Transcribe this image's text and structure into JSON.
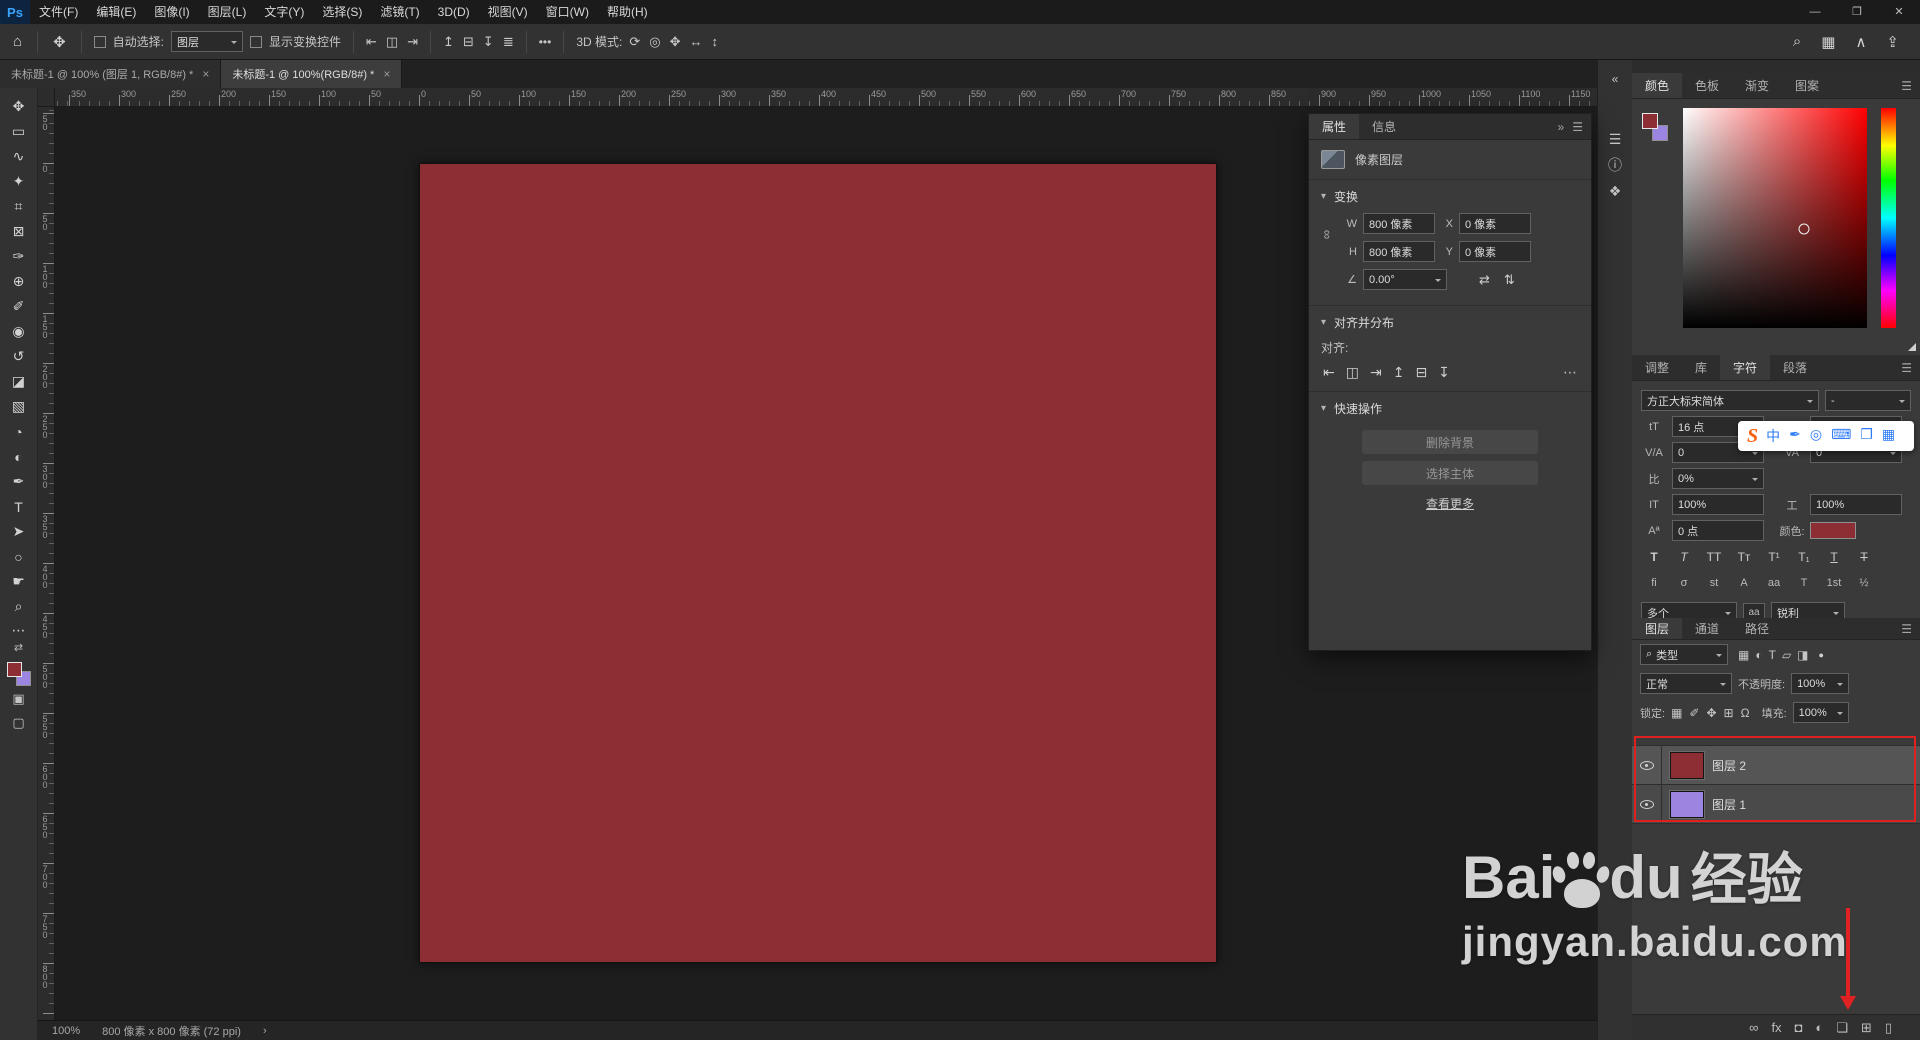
{
  "colors": {
    "doc_red": "#8c2e33",
    "purple": "#9c85e0",
    "annotation": "#e01f1f"
  },
  "menu": {
    "logo": "Ps",
    "items": [
      "文件(F)",
      "编辑(E)",
      "图像(I)",
      "图层(L)",
      "文字(Y)",
      "选择(S)",
      "滤镜(T)",
      "3D(D)",
      "视图(V)",
      "窗口(W)",
      "帮助(H)"
    ]
  },
  "window_controls": [
    {
      "name": "minimize-button",
      "glyph": "—"
    },
    {
      "name": "restore-button",
      "glyph": "❐"
    },
    {
      "name": "close-button",
      "glyph": "✕"
    }
  ],
  "options_bar": {
    "home_glyph": "⌂",
    "tool_glyph": "✥",
    "auto_select_label": "自动选择:",
    "auto_select_value": "图层",
    "show_transform_label": "显示变换控件",
    "align_icons_1": [
      {
        "name": "align-left-icon",
        "glyph": "⇤"
      },
      {
        "name": "align-center-horizontal-icon",
        "glyph": "◫"
      },
      {
        "name": "align-right-icon",
        "glyph": "⇥"
      }
    ],
    "align_icons_2": [
      {
        "name": "align-top-icon",
        "glyph": "↥"
      },
      {
        "name": "align-middle-vertical-icon",
        "glyph": "⊟"
      },
      {
        "name": "align-bottom-icon",
        "glyph": "↧"
      },
      {
        "name": "distribute-icon",
        "glyph": "≣"
      }
    ],
    "ellipsis": "•••",
    "mode_3d_label": "3D 模式:",
    "mode_3d_icons": [
      {
        "name": "3d-orbit-icon",
        "glyph": "⟳"
      },
      {
        "name": "3d-roll-icon",
        "glyph": "◎"
      },
      {
        "name": "3d-pan-icon",
        "glyph": "✥"
      },
      {
        "name": "3d-slide-icon",
        "glyph": "↔"
      },
      {
        "name": "3d-scale-icon",
        "glyph": "↕"
      }
    ],
    "right_icons": [
      {
        "name": "search-icon",
        "glyph": "⌕"
      },
      {
        "name": "workspace-switcher-icon",
        "glyph": "▦"
      },
      {
        "name": "chevron-icon",
        "glyph": "∧"
      },
      {
        "name": "share-icon",
        "glyph": "⇪"
      }
    ]
  },
  "doc_tabs": [
    {
      "label": "未标题-1 @ 100% (图层 1, RGB/8#) *",
      "close": "×",
      "cls": ""
    },
    {
      "label": "未标题-1 @ 100%(RGB/8#) *",
      "close": "×",
      "cls": "active"
    }
  ],
  "tools": [
    {
      "name": "move-tool",
      "glyph": "✥"
    },
    {
      "name": "rectangular-marquee-tool",
      "glyph": "▭"
    },
    {
      "name": "lasso-tool",
      "glyph": "∿"
    },
    {
      "name": "quick-selection-tool",
      "glyph": "✦"
    },
    {
      "name": "crop-tool",
      "glyph": "⌗"
    },
    {
      "name": "frame-tool",
      "glyph": "⊠"
    },
    {
      "name": "eyedropper-tool",
      "glyph": "✑"
    },
    {
      "name": "spot-healing-brush-tool",
      "glyph": "⊕"
    },
    {
      "name": "brush-tool",
      "glyph": "✐"
    },
    {
      "name": "clone-stamp-tool",
      "glyph": "◉"
    },
    {
      "name": "history-brush-tool",
      "glyph": "↺"
    },
    {
      "name": "eraser-tool",
      "glyph": "◪"
    },
    {
      "name": "gradient-tool",
      "glyph": "▧"
    },
    {
      "name": "blur-tool",
      "glyph": "◔"
    },
    {
      "name": "dodge-tool",
      "glyph": "◐"
    },
    {
      "name": "pen-tool",
      "glyph": "✒"
    },
    {
      "name": "type-tool",
      "glyph": "T"
    },
    {
      "name": "path-selection-tool",
      "glyph": "➤"
    },
    {
      "name": "ellipse-tool",
      "glyph": "○"
    },
    {
      "name": "hand-tool",
      "glyph": "☛"
    },
    {
      "name": "zoom-tool",
      "glyph": "⌕"
    }
  ],
  "toolbar_extras": {
    "more_glyph": "⋯",
    "swap_glyph": "⇄",
    "quickmask_glyph": "▣",
    "screenmode_glyph": "▢"
  },
  "rulers": {
    "h_labels": [
      "350",
      "300",
      "250",
      "200",
      "150",
      "100",
      "50",
      "0",
      "50",
      "100",
      "150",
      "200",
      "250",
      "300",
      "350",
      "400",
      "450",
      "500",
      "550",
      "600",
      "650",
      "700",
      "750",
      "800",
      "850",
      "900",
      "950",
      "1000",
      "1050",
      "1100",
      "1150"
    ],
    "v_labels": [
      "50",
      "0",
      "50",
      "100",
      "150",
      "200",
      "250",
      "300",
      "350",
      "400",
      "450",
      "500",
      "550",
      "600",
      "650",
      "700",
      "750",
      "800"
    ]
  },
  "canvas": {
    "color": "#8c2e33"
  },
  "status_bar": {
    "zoom": "100%",
    "doc_info": "800 像素 x 800 像素 (72 ppi)",
    "chevron": "›"
  },
  "props_panel": {
    "tabs": [
      {
        "label": "属性",
        "cls": "active"
      },
      {
        "label": "信息",
        "cls": ""
      }
    ],
    "collapse_glyph": "»",
    "menu_glyph": "☰",
    "layer_type": "像素图层",
    "section_caret": "▾",
    "transform_title": "变换",
    "transform": {
      "link_glyph": "∞",
      "w_label": "W",
      "w_value": "800 像素",
      "x_label": "X",
      "x_value": "0 像素",
      "h_label": "H",
      "h_value": "800 像素",
      "y_label": "Y",
      "y_value": "0 像素",
      "angle_glyph": "∠",
      "angle_value": "0.00°",
      "flip_h_glyph": "⇄",
      "flip_v_glyph": "⇅"
    },
    "align_title": "对齐并分布",
    "align_label": "对齐:",
    "align_icons": [
      {
        "name": "align-left-icon",
        "glyph": "⇤"
      },
      {
        "name": "align-center-horizontal-icon",
        "glyph": "◫"
      },
      {
        "name": "align-right-icon",
        "glyph": "⇥"
      },
      {
        "name": "align-top-icon",
        "glyph": "↥"
      },
      {
        "name": "align-middle-vertical-icon",
        "glyph": "⊟"
      },
      {
        "name": "align-bottom-icon",
        "glyph": "↧"
      }
    ],
    "align_more": "⋯",
    "quick_title": "快速操作",
    "remove_bg_label": "删除背景",
    "select_subject_label": "选择主体",
    "see_more_label": "查看更多"
  },
  "right_strip": [
    {
      "name": "collapse-panels-icon",
      "glyph": "«"
    },
    {
      "name": "adjustments-panel-icon",
      "glyph": "☰"
    },
    {
      "name": "info-panel-icon",
      "glyph": "ⓘ"
    },
    {
      "name": "3d-panel-icon",
      "glyph": "❖"
    }
  ],
  "color_panel": {
    "tabs": [
      {
        "label": "颜色",
        "cls": "active"
      },
      {
        "label": "色板",
        "cls": ""
      },
      {
        "label": "渐变",
        "cls": ""
      },
      {
        "label": "图案",
        "cls": ""
      }
    ],
    "menu_glyph": "☰",
    "foreground": "#8c2e33",
    "background": "#9c85e0",
    "cursor": {
      "left": "66%",
      "top": "55%"
    }
  },
  "mid_tabs": [
    {
      "label": "调整",
      "cls": ""
    },
    {
      "label": "库",
      "cls": ""
    },
    {
      "label": "字符",
      "cls": "active"
    },
    {
      "label": "段落",
      "cls": ""
    }
  ],
  "char_panel": {
    "font_family": "方正大标宋简体",
    "font_style": "-",
    "size_icon": "tT",
    "size_value": "16 点",
    "leading_icon": "A",
    "leading_value": "",
    "kern_icon": "V/A",
    "kern_value": "0",
    "track_icon": "VA",
    "track_value": "0",
    "prop_icon": "比",
    "prop_value": "0%",
    "vscale_icon": "IT",
    "vscale_value": "100%",
    "hscale_icon": "工",
    "hscale_value": "100%",
    "baseline_icon": "Aª",
    "baseline_value": "0 点",
    "color_label": "颜色:",
    "style_buttons": [
      {
        "name": "faux-bold-icon",
        "glyph": "T",
        "cls": "sb-bold"
      },
      {
        "name": "faux-italic-icon",
        "glyph": "T",
        "cls": "sb-italic"
      },
      {
        "name": "all-caps-icon",
        "glyph": "TT",
        "cls": ""
      },
      {
        "name": "small-caps-icon",
        "glyph": "Tᴛ",
        "cls": ""
      },
      {
        "name": "superscript-icon",
        "glyph": "T¹",
        "cls": ""
      },
      {
        "name": "subscript-icon",
        "glyph": "T₁",
        "cls": ""
      },
      {
        "name": "underline-icon",
        "glyph": "T",
        "cls": "sb-underline"
      },
      {
        "name": "strikethrough-icon",
        "glyph": "T",
        "cls": "sb-strike"
      }
    ],
    "ot_buttons": [
      {
        "name": "ligatures-icon",
        "glyph": "fi"
      },
      {
        "name": "swash-icon",
        "glyph": "σ"
      },
      {
        "name": "standard-ligatures-icon",
        "glyph": "st"
      },
      {
        "name": "titling-alternates-icon",
        "glyph": "A"
      },
      {
        "name": "stylistic-alternates-icon",
        "glyph": "aa"
      },
      {
        "name": "ordinals-icon",
        "glyph": "T"
      },
      {
        "name": "ordinal-icon",
        "glyph": "1st"
      },
      {
        "name": "fractions-icon",
        "glyph": "½"
      }
    ],
    "lang_value": "多个",
    "aa_icon": "aa",
    "aa_value": "锐利"
  },
  "sogou": {
    "logo": "S",
    "icons": [
      {
        "name": "chinese-mode-icon",
        "glyph": "中"
      },
      {
        "name": "punctuation-icon",
        "glyph": "✒"
      },
      {
        "name": "voice-input-icon",
        "glyph": "◎"
      },
      {
        "name": "soft-keyboard-icon",
        "glyph": "⌨"
      },
      {
        "name": "toolbox-icon",
        "glyph": "❒"
      },
      {
        "name": "skin-icon",
        "glyph": "▦"
      }
    ]
  },
  "layers_panel": {
    "tabs": [
      {
        "label": "图层",
        "cls": "active"
      },
      {
        "label": "通道",
        "cls": ""
      },
      {
        "label": "路径",
        "cls": ""
      }
    ],
    "menu_glyph": "☰",
    "search_glyph": "⌕",
    "filter_type": "类型",
    "filter_icons": [
      {
        "name": "filter-pixel-layers-icon",
        "glyph": "▦"
      },
      {
        "name": "filter-adjustment-layers-icon",
        "glyph": "◐"
      },
      {
        "name": "filter-type-layers-icon",
        "glyph": "T"
      },
      {
        "name": "filter-shape-layers-icon",
        "glyph": "▱"
      },
      {
        "name": "filter-smart-objects-icon",
        "glyph": "◨"
      }
    ],
    "filter_toggle_glyph": "●",
    "blend_value": "正常",
    "opacity_label": "不透明度:",
    "opacity_value": "100%",
    "lock_label": "锁定:",
    "lock_icons": [
      {
        "name": "lock-transparency-icon",
        "glyph": "▦"
      },
      {
        "name": "lock-pixels-icon",
        "glyph": "✐"
      },
      {
        "name": "lock-position-icon",
        "glyph": "✥"
      },
      {
        "name": "lock-artboard-icon",
        "glyph": "⊞"
      },
      {
        "name": "lock-all-icon",
        "glyph": "Ω"
      }
    ],
    "fill_label": "填充:",
    "fill_value": "100%",
    "layers": [
      {
        "label": "图层 2",
        "color": "#8c2e33",
        "cls": "selected"
      },
      {
        "label": "图层 1",
        "color": "#9c85e0",
        "cls": "selected2"
      }
    ],
    "bottom_icons": [
      {
        "name": "link-layers-icon",
        "glyph": "∞"
      },
      {
        "name": "layer-style-icon",
        "glyph": "fx"
      },
      {
        "name": "add-layer-mask-icon",
        "glyph": "◘"
      },
      {
        "name": "new-adjustment-layer-icon",
        "glyph": "◐"
      },
      {
        "name": "new-group-icon",
        "glyph": "❏"
      },
      {
        "name": "new-layer-icon",
        "glyph": "⊞"
      },
      {
        "name": "delete-layer-icon",
        "glyph": "▯"
      }
    ]
  },
  "watermark": {
    "text_bai": "Bai",
    "text_du": "du",
    "text_cn": "经验",
    "url": "jingyan.baidu.com"
  }
}
